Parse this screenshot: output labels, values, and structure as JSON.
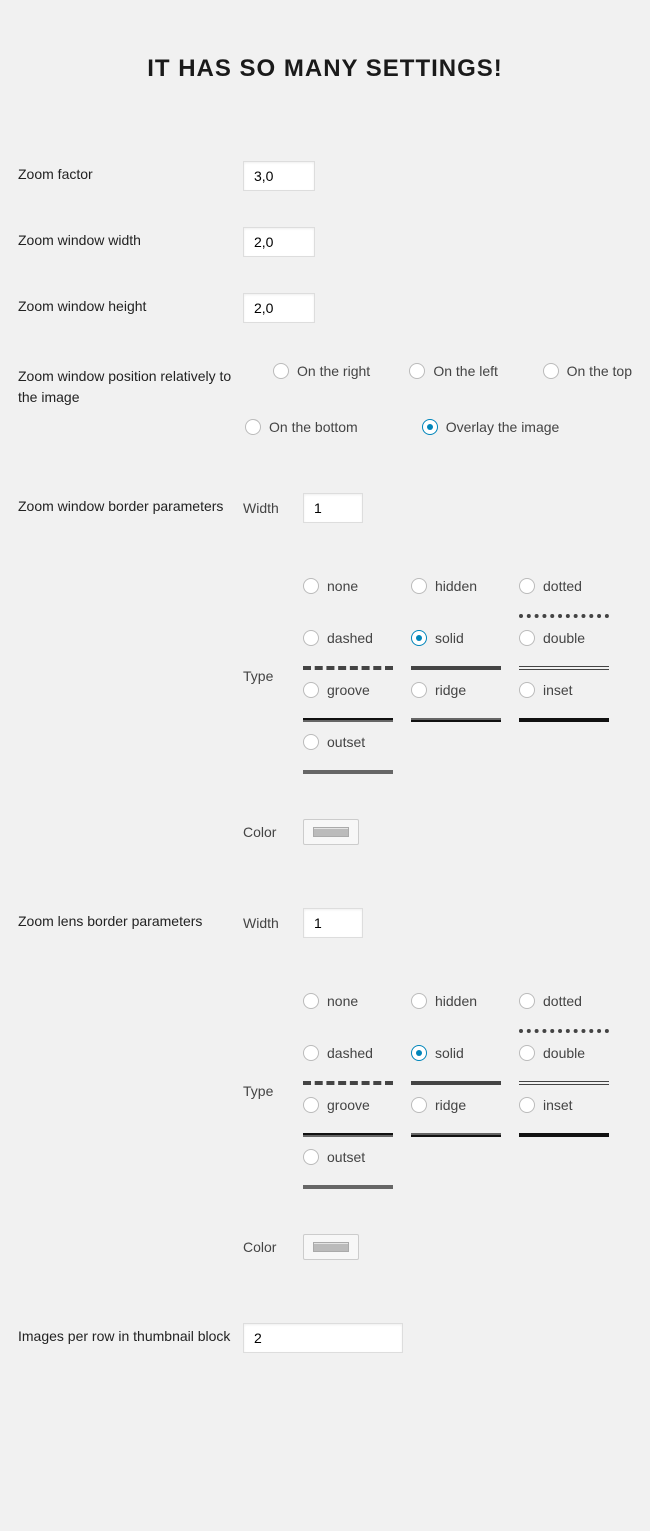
{
  "title": "IT HAS SO MANY SETTINGS!",
  "labels": {
    "zoom_factor": "Zoom factor",
    "zoom_window_width": "Zoom window width",
    "zoom_window_height": "Zoom window height",
    "zoom_window_position": "Zoom window position relatively to the image",
    "zoom_window_border": "Zoom window border parameters",
    "zoom_lens_border": "Zoom lens border parameters",
    "images_per_row": "Images per row in thumbnail block",
    "width": "Width",
    "type": "Type",
    "color": "Color"
  },
  "values": {
    "zoom_factor": "3,0",
    "zoom_window_width": "2,0",
    "zoom_window_height": "2,0",
    "win_border_width": "1",
    "lens_border_width": "1",
    "images_per_row": "2"
  },
  "position_opts": {
    "right": "On the right",
    "left": "On the left",
    "top": "On the top",
    "bottom": "On the bottom",
    "overlay": "Overlay the image",
    "selected": "overlay"
  },
  "border_types": {
    "none": "none",
    "hidden": "hidden",
    "dotted": "dotted",
    "dashed": "dashed",
    "solid": "solid",
    "double": "double",
    "groove": "groove",
    "ridge": "ridge",
    "inset": "inset",
    "outset": "outset",
    "win_selected": "solid",
    "lens_selected": "solid"
  },
  "colors": {
    "win_border": "#bbbbbb",
    "lens_border": "#bbbbbb"
  }
}
